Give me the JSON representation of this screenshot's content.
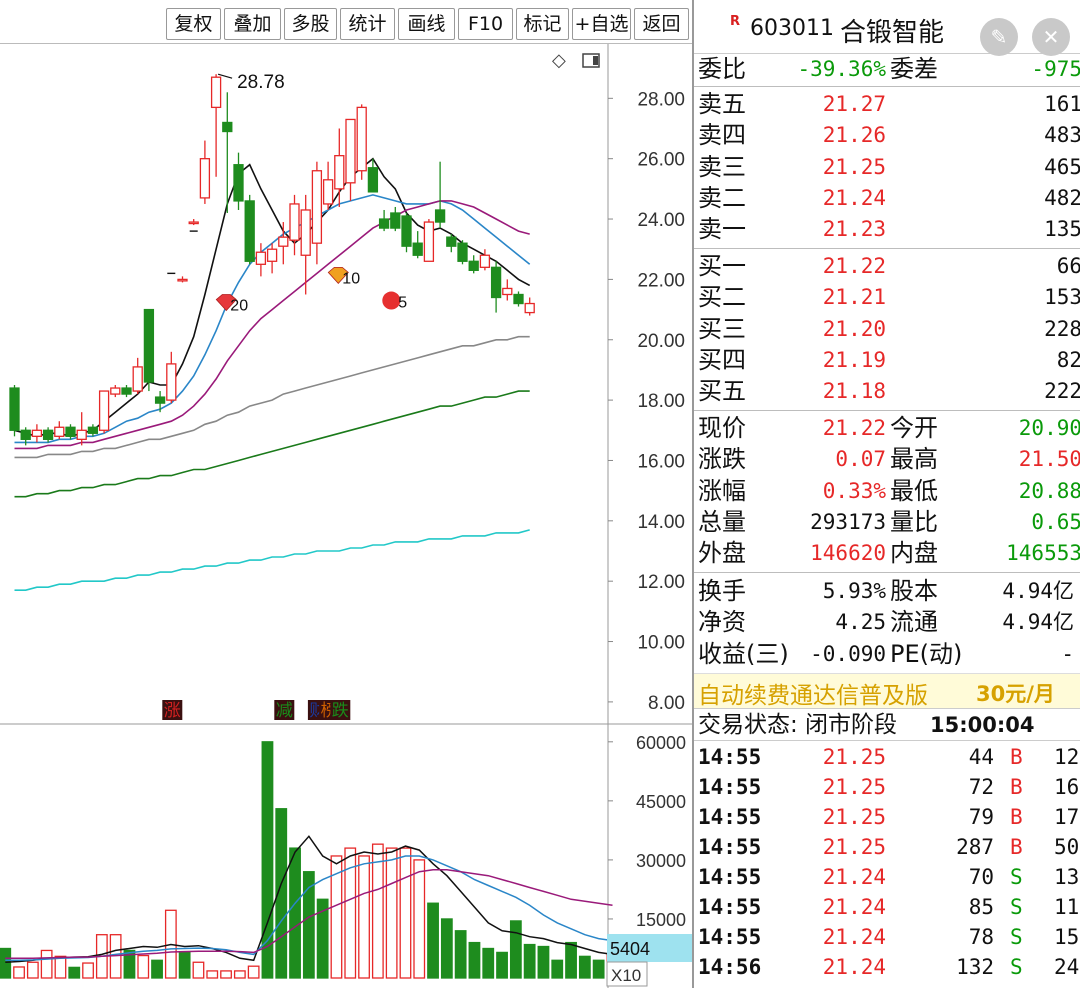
{
  "toolbar": {
    "buttons": [
      "复权",
      "叠加",
      "多股",
      "统计",
      "画线",
      "F10",
      "标记",
      "+自选",
      "返回"
    ]
  },
  "chart_data": [
    {
      "type": "candlestick",
      "title": "",
      "y_ticks": [
        "28.00",
        "26.00",
        "24.00",
        "22.00",
        "20.00",
        "18.00",
        "16.00",
        "14.00",
        "12.00",
        "10.00",
        "8.00"
      ],
      "ylim": [
        7.4,
        29.8
      ],
      "high_label": "28.78",
      "candles": [
        {
          "o": 18.4,
          "c": 17.0,
          "h": 18.5,
          "l": 16.8
        },
        {
          "o": 17.0,
          "c": 16.7,
          "h": 17.1,
          "l": 16.5
        },
        {
          "o": 16.8,
          "c": 17.0,
          "h": 17.2,
          "l": 16.6
        },
        {
          "o": 17.0,
          "c": 16.7,
          "h": 17.1,
          "l": 16.6
        },
        {
          "o": 16.8,
          "c": 17.1,
          "h": 17.3,
          "l": 16.7
        },
        {
          "o": 17.1,
          "c": 16.8,
          "h": 17.2,
          "l": 16.7
        },
        {
          "o": 16.7,
          "c": 17.0,
          "h": 17.6,
          "l": 16.5
        },
        {
          "o": 17.1,
          "c": 16.9,
          "h": 17.2,
          "l": 16.8
        },
        {
          "o": 17.0,
          "c": 18.3,
          "h": 18.3,
          "l": 16.9
        },
        {
          "o": 18.2,
          "c": 18.4,
          "h": 18.5,
          "l": 18.1
        },
        {
          "o": 18.4,
          "c": 18.2,
          "h": 18.5,
          "l": 18.1
        },
        {
          "o": 18.3,
          "c": 19.1,
          "h": 19.4,
          "l": 18.2
        },
        {
          "o": 21.0,
          "c": 18.6,
          "h": 21.0,
          "l": 18.3
        },
        {
          "o": 18.1,
          "c": 17.9,
          "h": 18.3,
          "l": 17.6
        },
        {
          "o": 18.0,
          "c": 19.2,
          "h": 19.6,
          "l": 17.9
        },
        {
          "o": 22.0,
          "c": 22.0,
          "h": 22.1,
          "l": 21.9
        },
        {
          "o": 23.9,
          "c": 23.9,
          "h": 24.0,
          "l": 23.8
        },
        {
          "o": 24.7,
          "c": 26.0,
          "h": 26.6,
          "l": 24.5
        },
        {
          "o": 27.7,
          "c": 28.7,
          "h": 28.8,
          "l": 25.4
        },
        {
          "o": 27.2,
          "c": 26.9,
          "h": 28.2,
          "l": 24.2
        },
        {
          "o": 25.8,
          "c": 24.6,
          "h": 26.2,
          "l": 24.3
        },
        {
          "o": 24.6,
          "c": 22.6,
          "h": 24.8,
          "l": 22.5
        },
        {
          "o": 22.5,
          "c": 22.9,
          "h": 23.2,
          "l": 22.1
        },
        {
          "o": 22.6,
          "c": 23.0,
          "h": 23.2,
          "l": 22.2
        },
        {
          "o": 23.1,
          "c": 23.4,
          "h": 23.9,
          "l": 22.5
        },
        {
          "o": 23.3,
          "c": 24.5,
          "h": 24.8,
          "l": 22.8
        },
        {
          "o": 22.8,
          "c": 24.3,
          "h": 24.8,
          "l": 21.5
        },
        {
          "o": 23.2,
          "c": 25.6,
          "h": 25.9,
          "l": 22.5
        },
        {
          "o": 24.5,
          "c": 25.3,
          "h": 25.9,
          "l": 24.3
        },
        {
          "o": 25.0,
          "c": 26.1,
          "h": 27.0,
          "l": 24.4
        },
        {
          "o": 25.2,
          "c": 27.3,
          "h": 27.3,
          "l": 24.6
        },
        {
          "o": 25.6,
          "c": 27.7,
          "h": 27.8,
          "l": 25.3
        },
        {
          "o": 25.7,
          "c": 24.9,
          "h": 26.0,
          "l": 24.9
        },
        {
          "o": 24.0,
          "c": 23.7,
          "h": 24.3,
          "l": 23.6
        },
        {
          "o": 24.2,
          "c": 23.7,
          "h": 24.4,
          "l": 23.6
        },
        {
          "o": 24.1,
          "c": 23.1,
          "h": 24.2,
          "l": 22.9
        },
        {
          "o": 23.2,
          "c": 22.8,
          "h": 23.6,
          "l": 22.7
        },
        {
          "o": 22.6,
          "c": 23.9,
          "h": 24.0,
          "l": 22.6
        },
        {
          "o": 24.3,
          "c": 23.9,
          "h": 25.9,
          "l": 23.7
        },
        {
          "o": 23.4,
          "c": 23.1,
          "h": 23.5,
          "l": 22.9
        },
        {
          "o": 23.2,
          "c": 22.6,
          "h": 23.3,
          "l": 22.5
        },
        {
          "o": 22.6,
          "c": 22.3,
          "h": 22.8,
          "l": 22.2
        },
        {
          "o": 22.4,
          "c": 22.8,
          "h": 23.0,
          "l": 22.3
        },
        {
          "o": 22.4,
          "c": 21.4,
          "h": 22.6,
          "l": 20.9
        },
        {
          "o": 21.5,
          "c": 21.7,
          "h": 22.0,
          "l": 21.3
        },
        {
          "o": 21.5,
          "c": 21.2,
          "h": 21.6,
          "l": 21.1
        },
        {
          "o": 20.9,
          "c": 21.2,
          "h": 21.4,
          "l": 20.8
        }
      ],
      "moving_averages": [
        {
          "color": "#111111",
          "values": [
            17.0,
            16.9,
            16.8,
            16.9,
            16.9,
            16.8,
            16.9,
            17.0,
            17.3,
            17.6,
            17.9,
            18.2,
            18.6,
            18.5,
            18.5,
            19.2,
            20.1,
            21.5,
            23.0,
            24.5,
            25.5,
            25.8,
            25.0,
            24.3,
            23.6,
            23.2,
            23.5,
            23.9,
            24.3,
            24.9,
            25.4,
            25.7,
            26.0,
            25.4,
            25.0,
            24.2,
            23.8,
            23.6,
            23.7,
            23.5,
            23.2,
            23.0,
            22.8,
            22.6,
            22.3,
            22.0,
            21.8
          ]
        },
        {
          "color": "#2a86c8",
          "values": [
            16.6,
            16.6,
            16.6,
            16.6,
            16.7,
            16.7,
            16.8,
            16.8,
            16.9,
            17.1,
            17.3,
            17.4,
            17.6,
            17.7,
            17.9,
            18.3,
            18.8,
            19.5,
            20.3,
            21.2,
            21.9,
            22.5,
            22.9,
            23.2,
            23.5,
            23.7,
            23.9,
            24.1,
            24.3,
            24.5,
            24.6,
            24.7,
            24.8,
            24.7,
            24.6,
            24.5,
            24.5,
            24.5,
            24.6,
            24.5,
            24.3,
            24.0,
            23.7,
            23.4,
            23.1,
            22.8,
            22.5
          ]
        },
        {
          "color": "#9a1a7a",
          "values": [
            16.4,
            16.4,
            16.4,
            16.5,
            16.5,
            16.5,
            16.6,
            16.6,
            16.7,
            16.8,
            16.9,
            17.0,
            17.1,
            17.2,
            17.3,
            17.5,
            17.8,
            18.2,
            18.7,
            19.3,
            19.8,
            20.3,
            20.7,
            21.0,
            21.3,
            21.6,
            21.9,
            22.2,
            22.5,
            22.8,
            23.1,
            23.4,
            23.7,
            23.9,
            24.1,
            24.3,
            24.4,
            24.5,
            24.6,
            24.6,
            24.5,
            24.4,
            24.2,
            24.0,
            23.8,
            23.6,
            23.5
          ]
        },
        {
          "color": "#888888",
          "values": [
            16.1,
            16.1,
            16.1,
            16.2,
            16.2,
            16.2,
            16.3,
            16.3,
            16.4,
            16.4,
            16.5,
            16.6,
            16.7,
            16.7,
            16.8,
            16.9,
            17.0,
            17.2,
            17.3,
            17.5,
            17.6,
            17.8,
            17.9,
            18.0,
            18.2,
            18.3,
            18.4,
            18.5,
            18.6,
            18.7,
            18.8,
            18.9,
            19.0,
            19.1,
            19.2,
            19.3,
            19.4,
            19.5,
            19.6,
            19.7,
            19.8,
            19.8,
            19.9,
            20.0,
            20.0,
            20.1,
            20.1
          ]
        },
        {
          "color": "#1a7a1a",
          "values": [
            14.8,
            14.8,
            14.9,
            14.9,
            15.0,
            15.0,
            15.1,
            15.1,
            15.2,
            15.2,
            15.3,
            15.4,
            15.4,
            15.5,
            15.5,
            15.6,
            15.7,
            15.7,
            15.8,
            15.9,
            16.0,
            16.1,
            16.2,
            16.3,
            16.4,
            16.5,
            16.6,
            16.7,
            16.8,
            16.9,
            17.0,
            17.1,
            17.2,
            17.3,
            17.4,
            17.5,
            17.6,
            17.7,
            17.8,
            17.8,
            17.9,
            18.0,
            18.1,
            18.1,
            18.2,
            18.3,
            18.3
          ]
        },
        {
          "color": "#22c8c8",
          "values": [
            11.7,
            11.7,
            11.8,
            11.8,
            11.9,
            11.9,
            12.0,
            12.0,
            12.0,
            12.1,
            12.1,
            12.2,
            12.2,
            12.3,
            12.3,
            12.4,
            12.4,
            12.5,
            12.5,
            12.6,
            12.6,
            12.7,
            12.7,
            12.8,
            12.8,
            12.9,
            12.9,
            13.0,
            13.0,
            13.0,
            13.1,
            13.1,
            13.2,
            13.2,
            13.3,
            13.3,
            13.3,
            13.4,
            13.4,
            13.4,
            13.5,
            13.5,
            13.5,
            13.6,
            13.6,
            13.6,
            13.7
          ]
        }
      ],
      "markers": [
        {
          "label": "20",
          "index": 19,
          "y": 21.2
        },
        {
          "label": "10",
          "index": 29,
          "y": 22.1
        },
        {
          "label": "5",
          "index": 34,
          "y": 21.3
        }
      ],
      "event_tags": [
        {
          "text": "涨",
          "index": 14,
          "color": "#d02020"
        },
        {
          "text": "减",
          "index": 24,
          "color": "#1a8a1a"
        },
        {
          "text": "财",
          "index": 27,
          "color": "#1a3aa0"
        },
        {
          "text": "榜",
          "index": 28,
          "color": "#d06000"
        },
        {
          "text": "跌",
          "index": 29,
          "color": "#1a8a1a"
        }
      ]
    },
    {
      "type": "bar",
      "title": "",
      "y_ticks": [
        "60000",
        "45000",
        "30000",
        "15000"
      ],
      "ylim": [
        0,
        63000
      ],
      "current_value_label": "5404",
      "multiplier_label": "X10",
      "values": [
        7500,
        2800,
        4000,
        7000,
        5500,
        2700,
        3800,
        11000,
        11000,
        7000,
        5700,
        4500,
        17200,
        6700,
        4000,
        1800,
        1800,
        1800,
        3000,
        60000,
        43000,
        33000,
        27000,
        20000,
        31000,
        33000,
        31000,
        34000,
        33000,
        33000,
        30000,
        19000,
        15000,
        12000,
        9000,
        7500,
        6500,
        14500,
        8500,
        8000,
        4500,
        9000,
        5500,
        4500,
        6000
      ],
      "up": [
        false,
        true,
        true,
        true,
        true,
        false,
        true,
        true,
        true,
        false,
        true,
        false,
        true,
        false,
        true,
        true,
        true,
        true,
        true,
        false,
        false,
        false,
        false,
        false,
        true,
        true,
        true,
        true,
        true,
        true,
        true,
        false,
        false,
        false,
        false,
        false,
        false,
        false,
        false,
        false,
        false,
        false,
        false,
        false,
        true
      ],
      "moving_averages": [
        {
          "color": "#111111",
          "values": [
            4000,
            4200,
            4500,
            5000,
            5200,
            5300,
            5400,
            6000,
            7000,
            7500,
            8000,
            7800,
            8500,
            8000,
            8200,
            7500,
            6500,
            5000,
            4500,
            14000,
            24000,
            32000,
            36000,
            31000,
            29000,
            31000,
            32000,
            31500,
            32000,
            33500,
            32500,
            29000,
            26000,
            22000,
            18000,
            14000,
            12000,
            11500,
            10500,
            10000,
            9000,
            8500,
            7500,
            6500,
            6000
          ]
        },
        {
          "color": "#2a86c8",
          "values": [
            4500,
            4500,
            4600,
            4800,
            5000,
            5100,
            5200,
            5500,
            6000,
            6400,
            6800,
            7000,
            7400,
            7500,
            7600,
            7500,
            7200,
            6500,
            6000,
            9500,
            14500,
            19000,
            23000,
            25000,
            26500,
            28000,
            29000,
            29500,
            30000,
            31000,
            31000,
            30000,
            28500,
            27000,
            25000,
            23500,
            22000,
            20500,
            18500,
            16000,
            14000,
            12500,
            11000,
            10000,
            9500
          ]
        },
        {
          "color": "#9a1a7a",
          "values": [
            5000,
            5000,
            5000,
            5100,
            5200,
            5300,
            5300,
            5500,
            5700,
            5900,
            6100,
            6300,
            6600,
            6700,
            6800,
            6800,
            6800,
            6700,
            6500,
            8000,
            10500,
            13000,
            15500,
            17000,
            18500,
            20000,
            21500,
            22500,
            24000,
            25500,
            27000,
            27500,
            27500,
            27000,
            26500,
            26000,
            25000,
            24000,
            23000,
            22000,
            21000,
            20000,
            19500,
            19000,
            18500
          ]
        }
      ]
    }
  ],
  "panel": {
    "r_mark": "R",
    "code": "603011",
    "name": "合锻智能",
    "edit_icon_glyph": "✎",
    "close_icon_glyph": "✕",
    "weibi": {
      "label": "委比",
      "value": "-39.36%",
      "label2": "委差",
      "value2": "-975"
    },
    "asks": [
      {
        "label": "卖五",
        "price": "21.27",
        "vol": "161"
      },
      {
        "label": "卖四",
        "price": "21.26",
        "vol": "483"
      },
      {
        "label": "卖三",
        "price": "21.25",
        "vol": "465"
      },
      {
        "label": "卖二",
        "price": "21.24",
        "vol": "482"
      },
      {
        "label": "卖一",
        "price": "21.23",
        "vol": "135"
      }
    ],
    "bids": [
      {
        "label": "买一",
        "price": "21.22",
        "vol": "66"
      },
      {
        "label": "买二",
        "price": "21.21",
        "vol": "153"
      },
      {
        "label": "买三",
        "price": "21.20",
        "vol": "228"
      },
      {
        "label": "买四",
        "price": "21.19",
        "vol": "82"
      },
      {
        "label": "买五",
        "price": "21.18",
        "vol": "222"
      }
    ],
    "quote": [
      {
        "l1": "现价",
        "v1": "21.22",
        "c1": "red",
        "l2": "今开",
        "v2": "20.90",
        "c2": "green"
      },
      {
        "l1": "涨跌",
        "v1": "0.07",
        "c1": "red",
        "l2": "最高",
        "v2": "21.50",
        "c2": "red"
      },
      {
        "l1": "涨幅",
        "v1": "0.33%",
        "c1": "red",
        "l2": "最低",
        "v2": "20.88",
        "c2": "green"
      },
      {
        "l1": "总量",
        "v1": "293173",
        "c1": "black",
        "l2": "量比",
        "v2": "0.65",
        "c2": "green"
      },
      {
        "l1": "外盘",
        "v1": "146620",
        "c1": "red",
        "l2": "内盘",
        "v2": "146553",
        "c2": "green"
      }
    ],
    "fundamentals": [
      {
        "l1": "换手",
        "v1": "5.93%",
        "l2": "股本",
        "v2": "4.94亿"
      },
      {
        "l1": "净资",
        "v1": "4.25",
        "l2": "流通",
        "v2": "4.94亿"
      },
      {
        "l1": "收益(三)",
        "v1": "-0.090",
        "l2": "PE(动)",
        "v2": "-"
      }
    ],
    "promo": {
      "text": "自动续费通达信普及版",
      "price": "30元/月"
    },
    "trade_status": {
      "label": "交易状态: 闭市阶段",
      "time": "15:00:04"
    },
    "ticks": [
      {
        "time": "14:55",
        "price": "21.25",
        "vol": "44",
        "bs": "B",
        "num": "12"
      },
      {
        "time": "14:55",
        "price": "21.25",
        "vol": "72",
        "bs": "B",
        "num": "16"
      },
      {
        "time": "14:55",
        "price": "21.25",
        "vol": "79",
        "bs": "B",
        "num": "17"
      },
      {
        "time": "14:55",
        "price": "21.25",
        "vol": "287",
        "bs": "B",
        "num": "50"
      },
      {
        "time": "14:55",
        "price": "21.24",
        "vol": "70",
        "bs": "S",
        "num": "13"
      },
      {
        "time": "14:55",
        "price": "21.24",
        "vol": "85",
        "bs": "S",
        "num": "11"
      },
      {
        "time": "14:55",
        "price": "21.24",
        "vol": "78",
        "bs": "S",
        "num": "15"
      },
      {
        "time": "14:56",
        "price": "21.24",
        "vol": "132",
        "bs": "S",
        "num": "24"
      }
    ]
  },
  "colors": {
    "up": "#e62828",
    "down": "#1e8c1e",
    "ask_price": "#e62828",
    "bid_price": "#e62828",
    "buy": "#e62828",
    "sell": "#0a9a0a"
  }
}
